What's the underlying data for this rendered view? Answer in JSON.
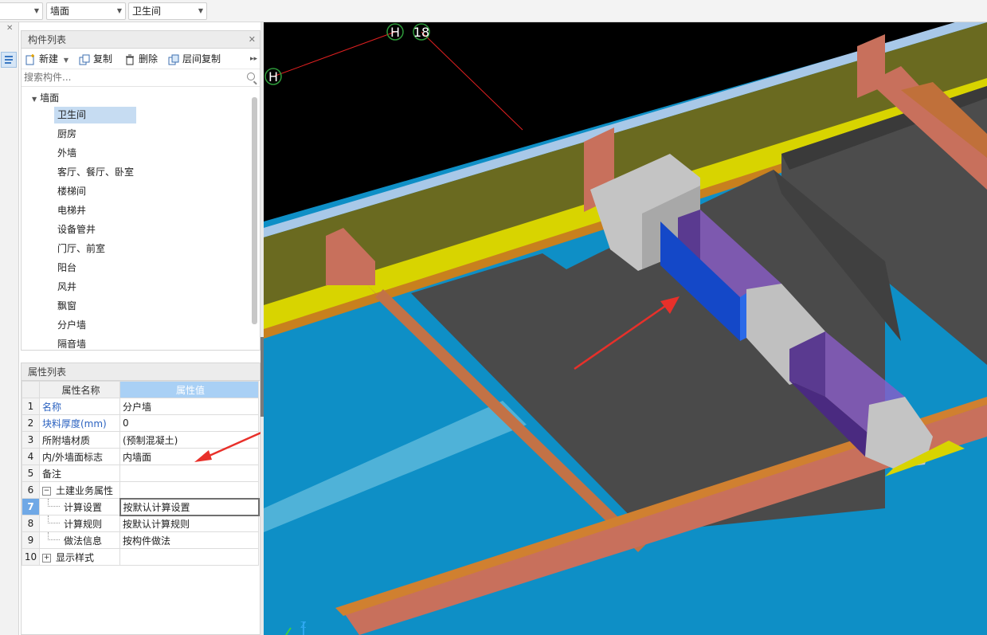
{
  "toolbar": {
    "combo1": "",
    "combo2": "墙面",
    "combo3": "卫生间"
  },
  "component_list": {
    "title": "构件列表",
    "new_label": "新建",
    "copy_label": "复制",
    "delete_label": "删除",
    "floor_copy_label": "层间复制",
    "search_placeholder": "搜索构件...",
    "root": "墙面",
    "items": [
      "卫生间",
      "厨房",
      "外墙",
      "客厅、餐厅、卧室",
      "楼梯间",
      "电梯井",
      "设备管井",
      "门厅、前室",
      "阳台",
      "风井",
      "飘窗",
      "分户墙",
      "隔音墙"
    ],
    "selected": "卫生间"
  },
  "property_list": {
    "title": "属性列表",
    "col_name": "属性名称",
    "col_value": "属性值",
    "rows": [
      {
        "num": "1",
        "name": "名称",
        "value": "分户墙"
      },
      {
        "num": "2",
        "name": "块料厚度(mm)",
        "value": "0"
      },
      {
        "num": "3",
        "name": "所附墙材质",
        "value": "(预制混凝土)"
      },
      {
        "num": "4",
        "name": "内/外墙面标志",
        "value": "内墙面"
      },
      {
        "num": "5",
        "name": "备注",
        "value": ""
      },
      {
        "num": "6",
        "name": "土建业务属性",
        "value": ""
      },
      {
        "num": "7",
        "name": "计算设置",
        "value": "按默认计算设置"
      },
      {
        "num": "8",
        "name": "计算规则",
        "value": "按默认计算规则"
      },
      {
        "num": "9",
        "name": "做法信息",
        "value": "按构件做法"
      },
      {
        "num": "10",
        "name": "显示样式",
        "value": ""
      }
    ],
    "expand_minus": "−",
    "expand_plus": "+"
  },
  "viewport": {
    "axis_h1": "H",
    "axis_18": "18",
    "axis_h2": "H",
    "coord_z": "Z"
  },
  "colors": {
    "selected_row": "#c6dcf2",
    "value_header": "#a9d0f5",
    "active_row_num": "#6fa8e6",
    "floor_blue": "#0e8fc6",
    "slab_gray": "#4a4a4a",
    "wall_yellow": "#d8d400",
    "beam_salmon": "#c8705c",
    "highlight_blue": "#1448c8",
    "annotation_red": "#e8302a"
  }
}
